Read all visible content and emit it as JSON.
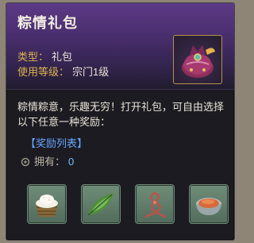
{
  "item": {
    "title": "粽情礼包",
    "type_label": "类型：",
    "type_value": "礼包",
    "level_label": "使用等级：",
    "level_value": "宗门1级",
    "icon": "gift-pouch-icon"
  },
  "description": "粽情粽意，乐趣无穷！打开礼包，可自由选择以下任意一种奖励：",
  "rewards_title": "【奖励列表】",
  "owned": {
    "label": "拥有：",
    "value": "0"
  },
  "rewards": [
    {
      "icon": "rice-basket-icon"
    },
    {
      "icon": "bamboo-leaf-icon"
    },
    {
      "icon": "red-string-icon"
    },
    {
      "icon": "red-powder-bowl-icon"
    }
  ],
  "colors": {
    "accent_label": "#d9b24c",
    "reward_title": "#69a6ff",
    "slot_bg": "#6f8d79"
  }
}
